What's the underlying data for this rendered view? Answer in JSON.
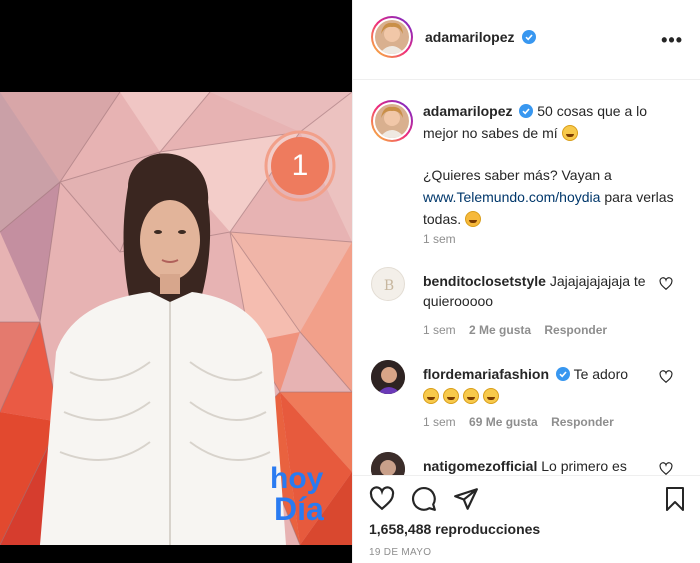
{
  "post": {
    "username": "adamarilopez",
    "more_icon": "more-horizontal-icon",
    "video_number": "1",
    "video_logo": [
      "hoy",
      "Día"
    ]
  },
  "caption": {
    "username": "adamarilopez",
    "text1": "50 cosas que a lo mejor no sabes de mí",
    "text2": "¿Quieres saber más? Vayan a",
    "link": "www.Telemundo.com/hoydia",
    "text3": "para verlas todas.",
    "time": "1 sem"
  },
  "comments": [
    {
      "username": "benditoclosetstyle",
      "text": "Jajajajajajaja te quierooooo",
      "time": "1 sem",
      "likes": "2 Me gusta",
      "reply": "Responder"
    },
    {
      "username": "flordemariafashion",
      "text": "Te adoro",
      "time": "1 sem",
      "likes": "69 Me gusta",
      "reply": "Responder"
    },
    {
      "username": "natigomezofficial",
      "text": "Lo primero es"
    }
  ],
  "footer": {
    "views": "1,658,488 reproducciones",
    "date": "19 DE MAYO"
  },
  "colors": {
    "link": "#00376b",
    "verified": "#3897f0",
    "secondary": "#8e8e8e"
  }
}
